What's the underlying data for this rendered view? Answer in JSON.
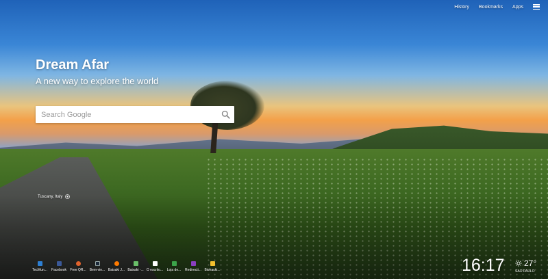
{
  "nav": {
    "history": "History",
    "bookmarks": "Bookmarks",
    "apps": "Apps"
  },
  "brand": {
    "title": "Dream Afar",
    "subtitle": "A new way to explore the world"
  },
  "search": {
    "placeholder": "Search Google"
  },
  "location": {
    "label": "Tuscany, Italy"
  },
  "shortcuts": [
    {
      "label": "TecMun...",
      "color": "#2d7fd3"
    },
    {
      "label": "Facebook",
      "color": "#3b5998"
    },
    {
      "label": "Free QR...",
      "color": "#e0622c"
    },
    {
      "label": "Bem-vin...",
      "color": "#1b2838"
    },
    {
      "label": "Baixaki J...",
      "color": "#ff7a00"
    },
    {
      "label": "Baixaki -...",
      "color": "#6abf69"
    },
    {
      "label": "O escrito...",
      "color": "#ffffff"
    },
    {
      "label": "Loja de...",
      "color": "#3ca54a"
    },
    {
      "label": "Redirecti...",
      "color": "#8a3fbf"
    },
    {
      "label": "Biohacki...",
      "color": "#f2c12e"
    }
  ],
  "clock": {
    "time": "16:17"
  },
  "weather": {
    "temp": "27°",
    "city": "SAO PAULO",
    "icon": "sun-icon"
  }
}
